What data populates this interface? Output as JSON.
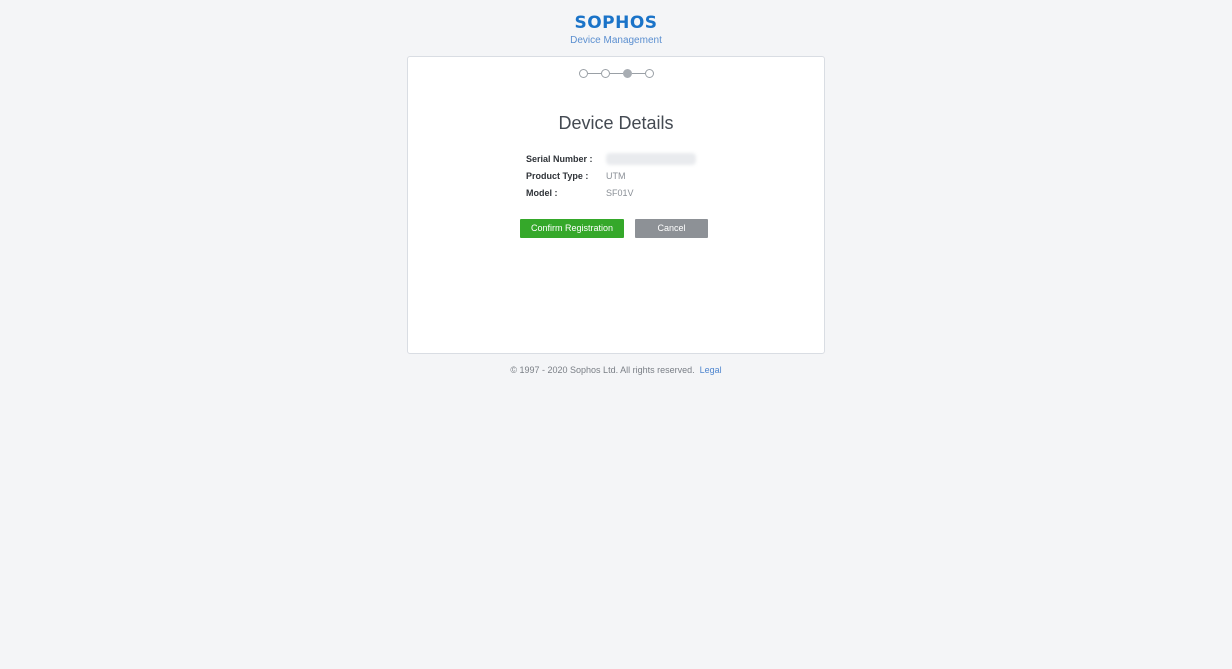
{
  "header": {
    "logo": "SOPHOS",
    "subtitle": "Device Management"
  },
  "steps": {
    "total": 4,
    "current": 3
  },
  "card": {
    "title": "Device Details",
    "fields": [
      {
        "label": "Serial Number :",
        "value": ""
      },
      {
        "label": "Product Type :",
        "value": "UTM"
      },
      {
        "label": "Model :",
        "value": "SF01V"
      }
    ],
    "confirm_label": "Confirm Registration",
    "cancel_label": "Cancel"
  },
  "footer": {
    "copyright": "© 1997 - 2020 Sophos Ltd. All rights reserved.",
    "legal_link": "Legal"
  },
  "colors": {
    "brand": "#1a73c8",
    "confirm": "#35a82a",
    "cancel": "#8d9196"
  }
}
